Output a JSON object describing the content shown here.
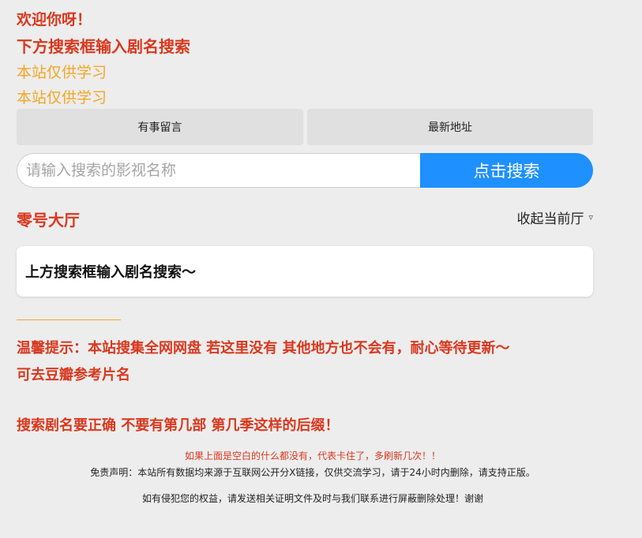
{
  "welcome": {
    "line1": "欢迎你呀！",
    "line2": "下方搜索框输入剧名搜索",
    "line3": "本站仅供学习",
    "line4": "本站仅供学习"
  },
  "buttons": {
    "message": "有事留言",
    "latest_address": "最新地址"
  },
  "search": {
    "placeholder": "请输入搜索的影视名称",
    "button_label": "点击搜索"
  },
  "hall": {
    "title": "零号大厅",
    "collapse_label": "收起当前厅",
    "collapse_icon": "triangle-down-icon"
  },
  "card": {
    "text": "上方搜索框输入剧名搜索～"
  },
  "tips": {
    "tip1": "温馨提示：本站搜集全网网盘 若这里没有 其他地方也不会有，耐心等待更新～",
    "tip2": "可去豆瓣参考片名",
    "tip3": "搜索剧名要正确 不要有第几部 第几季这样的后缀！"
  },
  "footer": {
    "red_note": "如果上面是空白的什么都没有，代表卡住了，多刷新几次！！",
    "disclaimer": "免责声明：本站所有数据均来源于互联网公开分X链接，仅供交流学习，请于24小时内删除，请支持正版。",
    "infringement": "如有侵犯您的权益，请发送相关证明文件及时与我们联系进行屏蔽删除处理！谢谢"
  },
  "colors": {
    "accent_red": "#d9381e",
    "accent_orange": "#f5a623",
    "search_blue": "#1e90ff",
    "background": "#ededed"
  }
}
